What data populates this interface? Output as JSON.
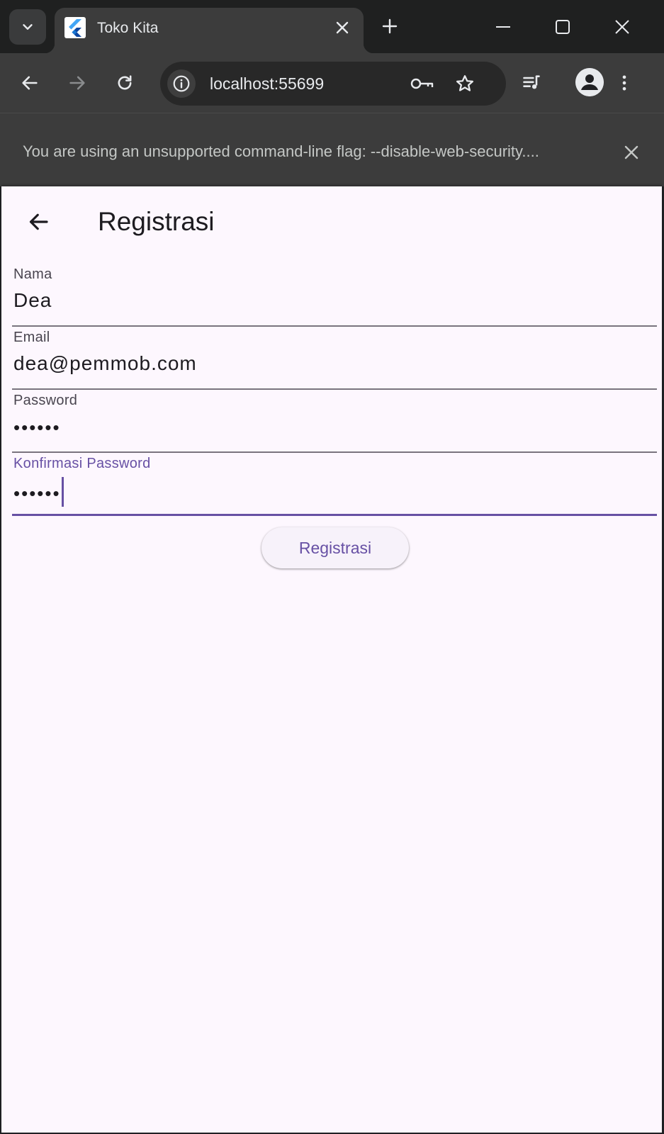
{
  "browser": {
    "tab_title": "Toko Kita",
    "url": "localhost:55699",
    "infobar_text": "You are using an unsupported command-line flag: --disable-web-security...."
  },
  "app": {
    "title": "Registrasi",
    "fields": {
      "nama": {
        "label": "Nama",
        "value": "Dea"
      },
      "email": {
        "label": "Email",
        "value": "dea@pemmob.com"
      },
      "password": {
        "label": "Password",
        "value": "••••••"
      },
      "konfirmasi": {
        "label": "Konfirmasi Password",
        "value": "••••••"
      }
    },
    "submit_label": "Registrasi"
  },
  "colors": {
    "primary": "#6750a4",
    "app_background": "#fdf7fe",
    "browser_frame": "#3c3c3c"
  },
  "icons": [
    "tab-search-icon",
    "flutter-icon",
    "close-icon",
    "plus-icon",
    "minimize-icon",
    "maximize-icon",
    "back-arrow-icon",
    "forward-arrow-icon",
    "reload-icon",
    "info-icon",
    "key-icon",
    "star-icon",
    "media-queue-icon",
    "profile-icon",
    "more-vert-icon",
    "arrow-back-icon"
  ]
}
